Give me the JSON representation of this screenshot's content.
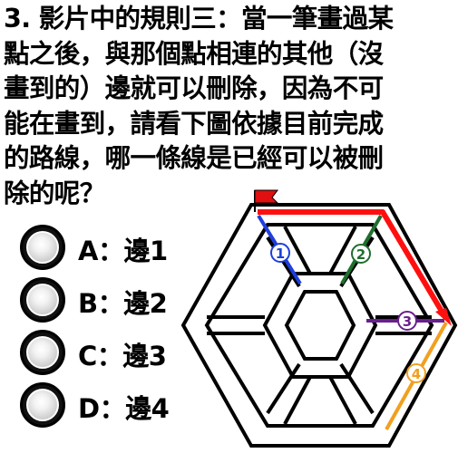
{
  "question": {
    "lines": [
      "3. 影片中的規則三：當一筆畫過某",
      "點之後，與那個點相連的其他（沒",
      "畫到的）邊就可以刪除，因為不可",
      "能在畫到，請看下圖依據目前完成",
      "的路線，哪一條線是已經可以被刪",
      "除的呢？"
    ]
  },
  "options": [
    {
      "label": "A：邊1"
    },
    {
      "label": "B：邊2"
    },
    {
      "label": "C：邊3"
    },
    {
      "label": "D：邊4"
    }
  ],
  "diagram": {
    "edge_labels": [
      "1",
      "2",
      "3",
      "4"
    ],
    "colors": {
      "path": "#ff1010",
      "edge1": "#1f3fdc",
      "edge2": "#1f6e2e",
      "edge3": "#6a1f8e",
      "edge4": "#f0a020",
      "flag": "#e01010"
    }
  }
}
